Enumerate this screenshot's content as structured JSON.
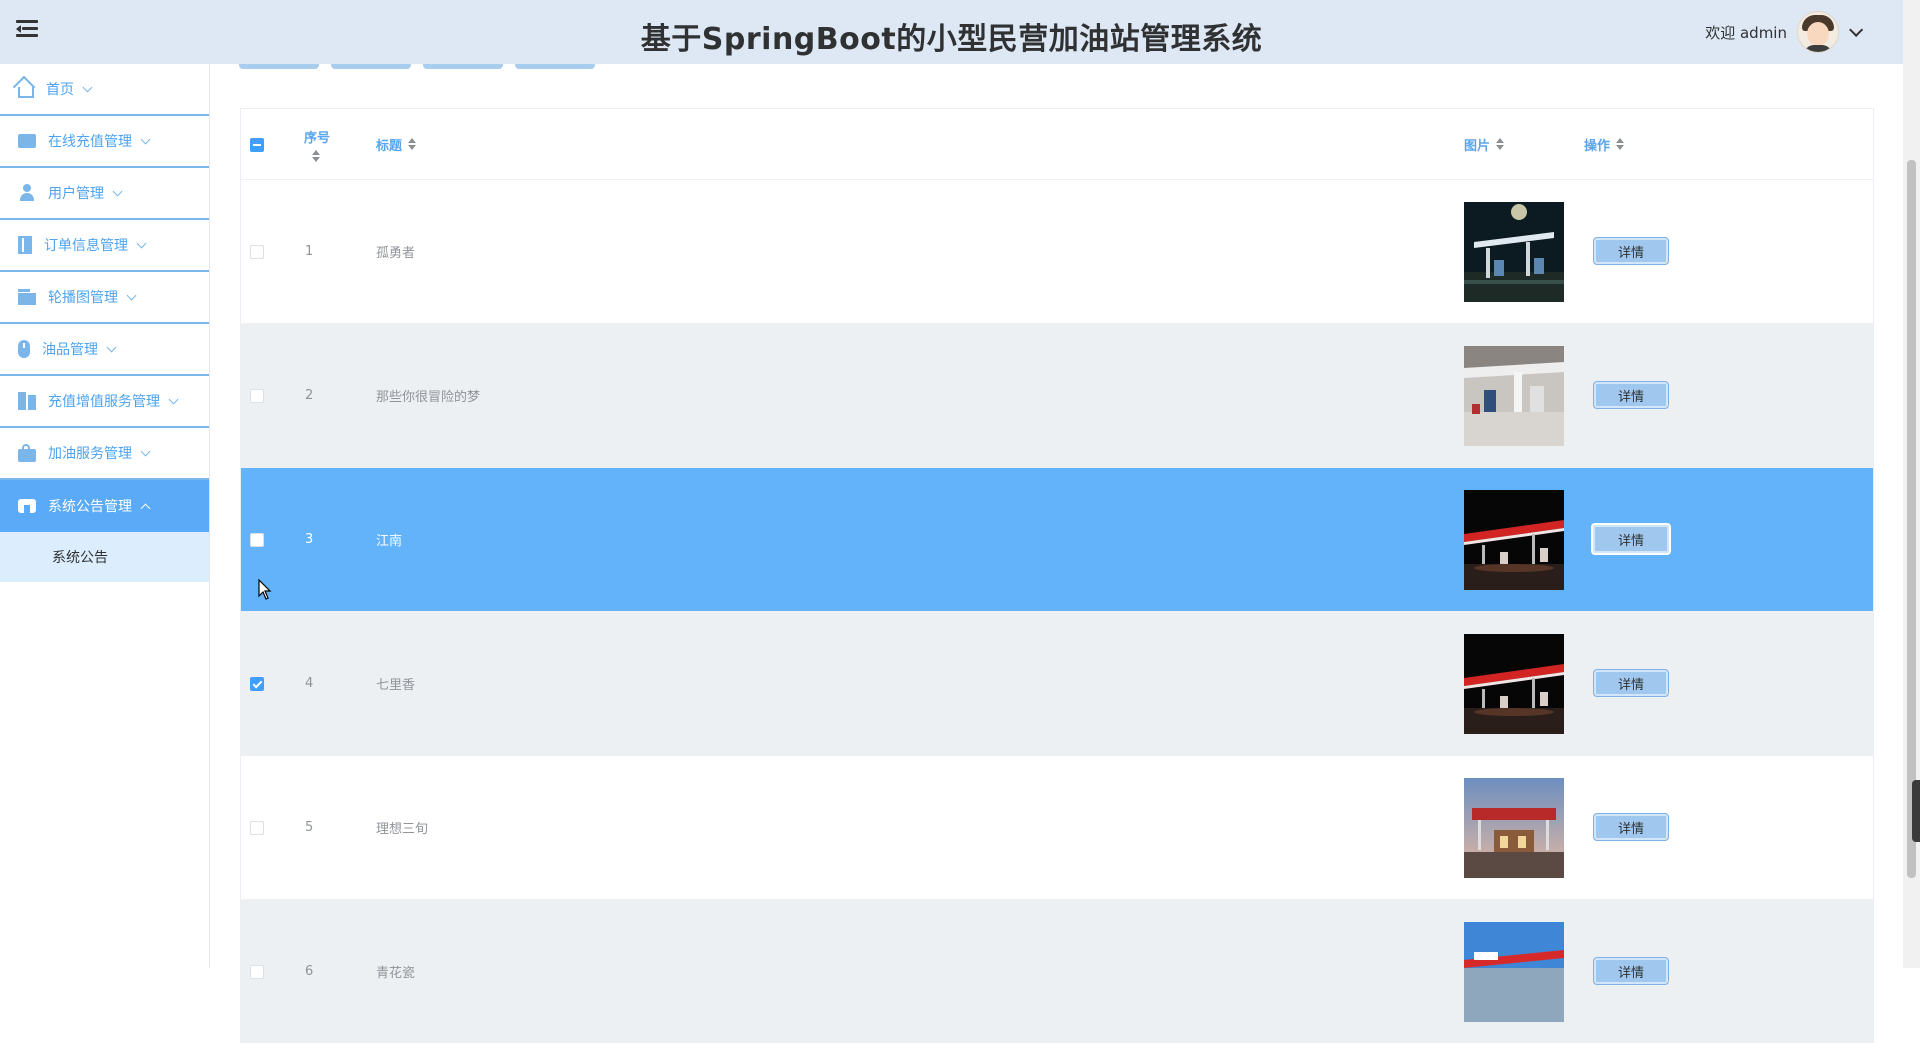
{
  "header": {
    "title": "基于SpringBoot的小型民营加油站管理系统",
    "welcome": "欢迎 admin"
  },
  "sidebar": {
    "items": [
      {
        "label": "首页",
        "icon": "home-icon"
      },
      {
        "label": "在线充值管理",
        "icon": "briefcase-icon"
      },
      {
        "label": "用户管理",
        "icon": "user-icon"
      },
      {
        "label": "订单信息管理",
        "icon": "book-icon"
      },
      {
        "label": "轮播图管理",
        "icon": "wallet-icon"
      },
      {
        "label": "油品管理",
        "icon": "mouse-icon"
      },
      {
        "label": "充值增值服务管理",
        "icon": "columns-icon"
      },
      {
        "label": "加油服务管理",
        "icon": "bag-icon"
      },
      {
        "label": "系统公告管理",
        "icon": "store-icon",
        "active": true
      }
    ],
    "sub_items": [
      {
        "label": "系统公告"
      }
    ]
  },
  "table": {
    "columns": [
      "序号",
      "标题",
      "图片",
      "操作"
    ],
    "rows": [
      {
        "index": "1",
        "title": "孤勇者",
        "checked": false,
        "image": "gas-station-night-photo"
      },
      {
        "index": "2",
        "title": "那些你很冒险的梦",
        "checked": false,
        "image": "gas-station-day-photo"
      },
      {
        "index": "3",
        "title": "江南",
        "checked": false,
        "image": "gas-station-red-canopy-photo"
      },
      {
        "index": "4",
        "title": "七里香",
        "checked": true,
        "image": "gas-station-red-canopy-photo"
      },
      {
        "index": "5",
        "title": "理想三旬",
        "checked": false,
        "image": "gas-station-dusk-photo"
      },
      {
        "index": "6",
        "title": "青花瓷",
        "checked": false,
        "image": "gas-station-blue-sky-photo"
      }
    ],
    "detail_label": "详情"
  },
  "colors": {
    "header_bg": "#dde8f4",
    "accent": "#5aaaf7",
    "hover_row": "#63b3fa",
    "striped_row": "#edf0f3",
    "sub_menu_bg": "#dceefe"
  }
}
